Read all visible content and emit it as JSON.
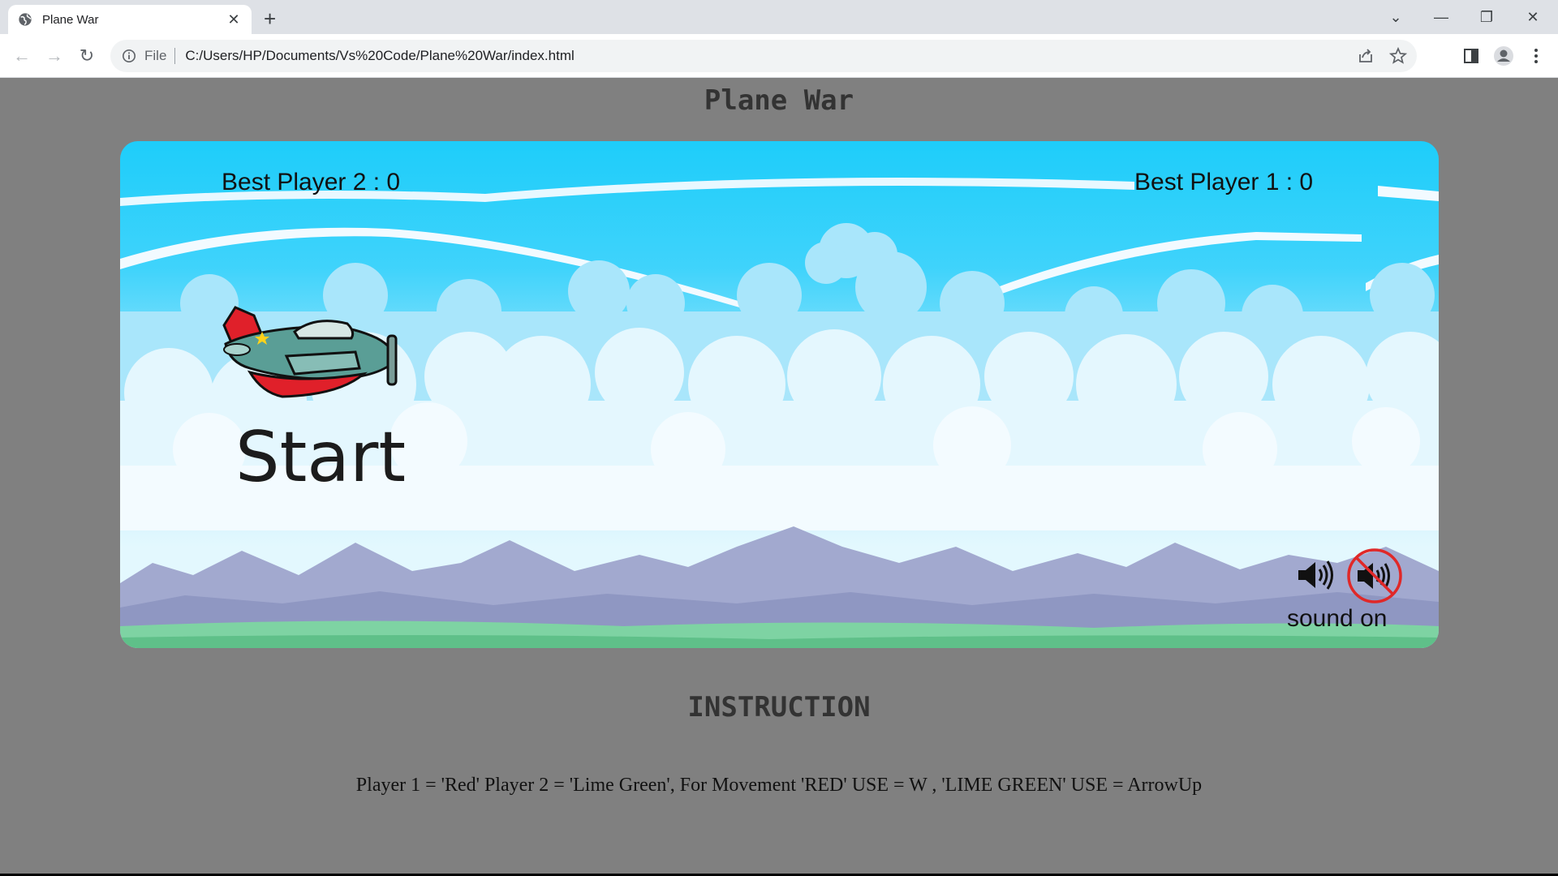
{
  "browser": {
    "tab_title": "Plane War",
    "new_tab_label": "+",
    "scheme_label": "File",
    "url": "C:/Users/HP/Documents/Vs%20Code/Plane%20War/index.html"
  },
  "page": {
    "title": "Plane War",
    "instruction_heading": "INSTRUCTION",
    "instruction_text": "Player 1 = 'Red' Player 2 = 'Lime Green', For Movement 'RED' USE = W , 'LIME GREEN' USE = ArrowUp"
  },
  "game": {
    "best_player_2": "Best Player 2 : 0",
    "best_player_1": "Best Player 1 : 0",
    "start_label": "Start",
    "sound_label": "sound on"
  },
  "colors": {
    "page_bg": "#808080",
    "sky_top": "#1ecdfa",
    "plane_body": "#5a9e96",
    "plane_red": "#e0202a",
    "mute_red": "#e02828"
  }
}
